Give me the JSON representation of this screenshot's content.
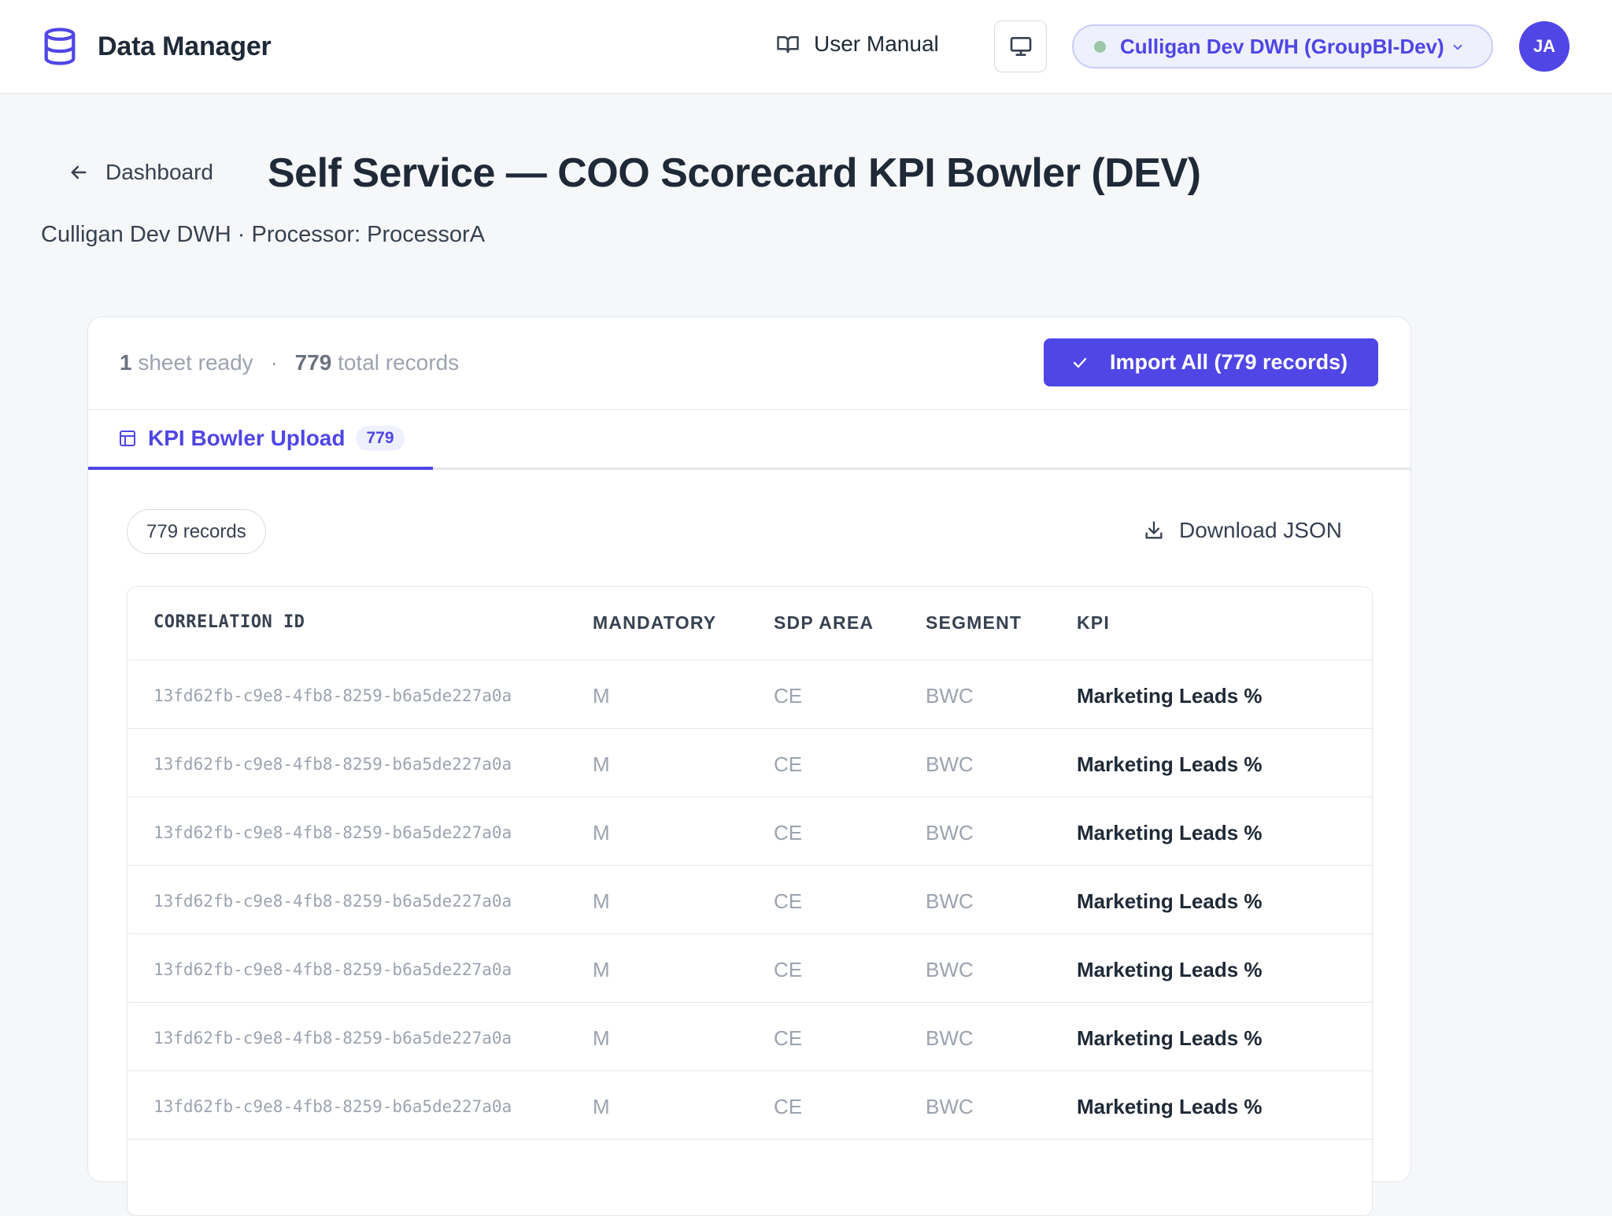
{
  "app": {
    "name": "Data Manager",
    "user_manual_label": "User Manual",
    "connection_label": "Culligan Dev DWH (GroupBI-Dev)",
    "connection_status_color": "#9bc7a8",
    "avatar_initials": "JA",
    "accent_color": "#4f46e5"
  },
  "page": {
    "back_label": "Dashboard",
    "title": "Self Service — COO Scorecard KPI Bowler (DEV)",
    "subtitle": "Culligan Dev DWH · Processor: ProcessorA"
  },
  "summary": {
    "sheets_count": "1",
    "sheets_label": "sheet ready",
    "separator": "·",
    "records_count": "779",
    "records_label": "total records",
    "import_button_label": "Import All (779 records)"
  },
  "tabs": [
    {
      "label": "KPI Bowler Upload",
      "count": "779",
      "active": true
    }
  ],
  "toolbar": {
    "records_pill": "779 records",
    "download_label": "Download JSON"
  },
  "table": {
    "columns": [
      "CORRELATION ID",
      "MANDATORY",
      "SDP AREA",
      "SEGMENT",
      "KPI"
    ],
    "rows": [
      [
        "13fd62fb-c9e8-4fb8-8259-b6a5de227a0a",
        "M",
        "CE",
        "BWC",
        "Marketing Leads %"
      ],
      [
        "13fd62fb-c9e8-4fb8-8259-b6a5de227a0a",
        "M",
        "CE",
        "BWC",
        "Marketing Leads %"
      ],
      [
        "13fd62fb-c9e8-4fb8-8259-b6a5de227a0a",
        "M",
        "CE",
        "BWC",
        "Marketing Leads %"
      ],
      [
        "13fd62fb-c9e8-4fb8-8259-b6a5de227a0a",
        "M",
        "CE",
        "BWC",
        "Marketing Leads %"
      ],
      [
        "13fd62fb-c9e8-4fb8-8259-b6a5de227a0a",
        "M",
        "CE",
        "BWC",
        "Marketing Leads %"
      ],
      [
        "13fd62fb-c9e8-4fb8-8259-b6a5de227a0a",
        "M",
        "CE",
        "BWC",
        "Marketing Leads %"
      ],
      [
        "13fd62fb-c9e8-4fb8-8259-b6a5de227a0a",
        "M",
        "CE",
        "BWC",
        "Marketing Leads %"
      ]
    ]
  }
}
